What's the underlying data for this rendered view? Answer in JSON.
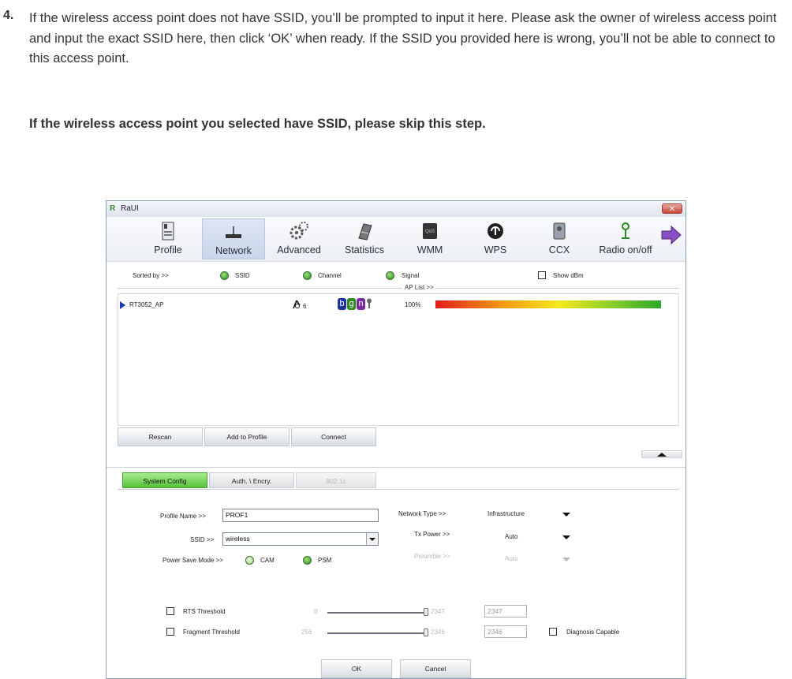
{
  "doc": {
    "step_number": "4.",
    "paragraph": "If the wireless access point does not have SSID, you’ll be prompted to input it here. Please ask the owner of wireless access point and input the exact SSID here, then click ‘OK’ when ready. If the SSID you provided here is wrong, you’ll not be able to connect to this access point.",
    "note": "If the wireless access point you selected have SSID, please skip this step."
  },
  "window": {
    "title": "RaUI",
    "close_glyph": "✕"
  },
  "toolbar": {
    "items": [
      {
        "label": "Profile",
        "icon": "profile-icon"
      },
      {
        "label": "Network",
        "icon": "network-icon"
      },
      {
        "label": "Advanced",
        "icon": "gears-icon"
      },
      {
        "label": "Statistics",
        "icon": "statistics-icon"
      },
      {
        "label": "WMM",
        "icon": "wmm-icon",
        "badge": "QoS"
      },
      {
        "label": "WPS",
        "icon": "wps-icon"
      },
      {
        "label": "CCX",
        "icon": "ccx-icon"
      },
      {
        "label": "Radio on/off",
        "icon": "radio-antenna-icon"
      }
    ],
    "active": "Network"
  },
  "sort": {
    "label": "Sorted by >>",
    "options": [
      "SSID",
      "Channel",
      "Signal"
    ],
    "selected": "SSID",
    "show_dbm_label": "Show dBm"
  },
  "ap_list": {
    "label": "AP List >>",
    "rows": [
      {
        "ssid": "RT3052_AP",
        "channel": "6",
        "modes": [
          "b",
          "g",
          "n"
        ],
        "signal": "100%",
        "signal_fraction": 1.0
      }
    ]
  },
  "buttons": {
    "rescan": "Rescan",
    "add_to_profile": "Add to Profile",
    "connect": "Connect",
    "ok": "OK",
    "cancel": "Cancel"
  },
  "tabs": [
    "System Config",
    "Auth. \\ Encry.",
    "802.1x"
  ],
  "config": {
    "profile_name_label": "Profile Name >>",
    "profile_name": "PROF1",
    "ssid_label": "SSID >>",
    "ssid": "wireless",
    "power_save_label": "Power Save Mode >>",
    "power_save_options": [
      "CAM",
      "PSM"
    ],
    "power_save_selected": "PSM",
    "network_type_label": "Network Type >>",
    "network_type": "Infrastructure",
    "tx_power_label": "Tx Power >>",
    "tx_power": "Auto",
    "preamble_label": "Preamble >>",
    "preamble": "Auto",
    "rts_label": "RTS Threshold",
    "rts_min": "0",
    "rts_max": "2347",
    "rts_value": "2347",
    "frag_label": "Fragment Threshold",
    "frag_min": "256",
    "frag_max": "2346",
    "frag_value": "2346",
    "diagnosis_label": "Diagnosis Capable"
  },
  "colors": {
    "accent_green": "#2d8a1c",
    "active_tab": "#6fd24f"
  }
}
